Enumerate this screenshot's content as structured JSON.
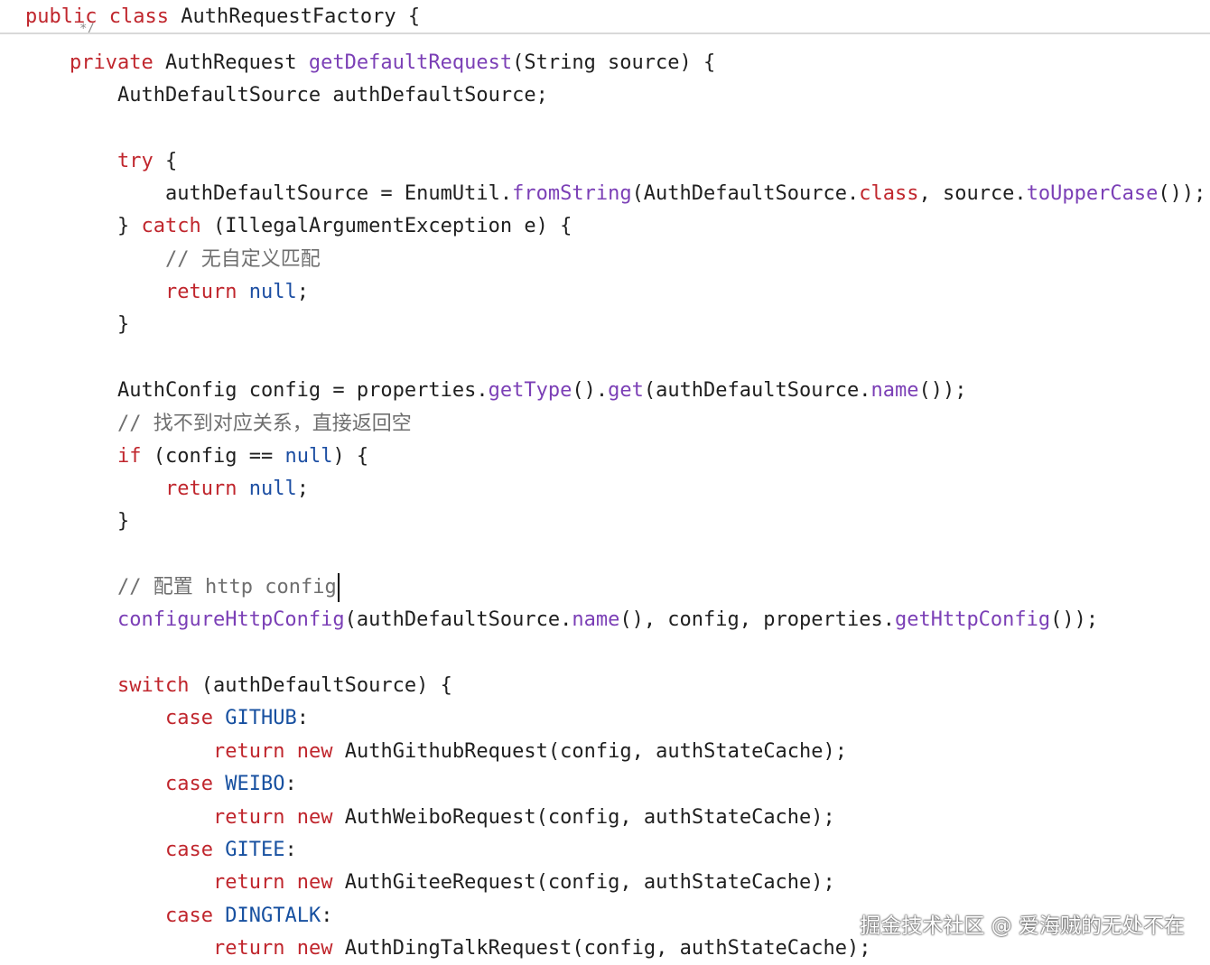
{
  "header": {
    "kw_public": "public",
    "kw_class": "class",
    "class_name": "AuthRequestFactory",
    "brace": "{",
    "clipped_comment": "*/"
  },
  "code": {
    "l01": {
      "kw": "private",
      "t1": "AuthRequest",
      "fn": "getDefaultRequest",
      "t2": "(String source) {"
    },
    "l02": {
      "t1": "AuthDefaultSource authDefaultSource;"
    },
    "l04": {
      "kw": "try",
      "t1": "{"
    },
    "l05": {
      "t1": "authDefaultSource = EnumUtil.",
      "fn1": "fromString",
      "t2": "(AuthDefaultSource.",
      "kw": "class",
      "t3": ", source.",
      "fn2": "toUpperCase",
      "t4": "());"
    },
    "l06": {
      "t1": "}",
      "kw": "catch",
      "t2": "(IllegalArgumentException e) {"
    },
    "l07": {
      "slashes": "//",
      "text": "无自定义匹配"
    },
    "l08": {
      "kw": "return",
      "lit": "null",
      "t1": ";"
    },
    "l09": {
      "t1": "}"
    },
    "l11": {
      "t1": "AuthConfig config = properties.",
      "fn1": "getType",
      "t2": "().",
      "fn2": "get",
      "t3": "(authDefaultSource.",
      "fn3": "name",
      "t4": "());"
    },
    "l12": {
      "slashes": "//",
      "text": "找不到对应关系，直接返回空"
    },
    "l13": {
      "kw": "if",
      "t1": "(config ==",
      "lit": "null",
      "t2": ") {"
    },
    "l14": {
      "kw": "return",
      "lit": "null",
      "t1": ";"
    },
    "l15": {
      "t1": "}"
    },
    "l17": {
      "slashes": "//",
      "text_cjk": "配置",
      "text_rest": "http config"
    },
    "l18": {
      "fn1": "configureHttpConfig",
      "t1": "(authDefaultSource.",
      "fn2": "name",
      "t2": "(), config, properties.",
      "fn3": "getHttpConfig",
      "t3": "());"
    },
    "l20": {
      "kw": "switch",
      "t1": "(authDefaultSource) {"
    },
    "l21": {
      "kw": "case",
      "const": "GITHUB",
      "t1": ":"
    },
    "l22": {
      "kw1": "return",
      "kw2": "new",
      "t1": "AuthGithubRequest(config, authStateCache);"
    },
    "l23": {
      "kw": "case",
      "const": "WEIBO",
      "t1": ":"
    },
    "l24": {
      "kw1": "return",
      "kw2": "new",
      "t1": "AuthWeiboRequest(config, authStateCache);"
    },
    "l25": {
      "kw": "case",
      "const": "GITEE",
      "t1": ":"
    },
    "l26": {
      "kw1": "return",
      "kw2": "new",
      "t1": "AuthGiteeRequest(config, authStateCache);"
    },
    "l27": {
      "kw": "case",
      "const": "DINGTALK",
      "t1": ":"
    },
    "l28": {
      "kw1": "return",
      "kw2": "new",
      "t1": "AuthDingTalkRequest(config, authStateCache);"
    }
  },
  "watermark": "掘金技术社区 @ 爱海贼的无处不在",
  "colors": {
    "keyword": "#c0262d",
    "literal": "#1d4fa3",
    "constant": "#1750a0",
    "method": "#7b3fb6",
    "comment": "#6f6f6f",
    "text": "#1f1f1f"
  }
}
